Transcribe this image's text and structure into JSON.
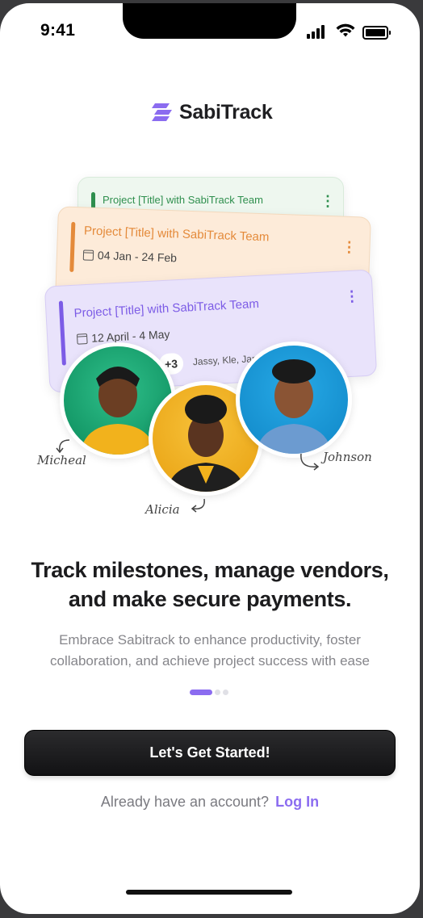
{
  "status_bar": {
    "time": "9:41"
  },
  "brand": {
    "name": "SabiTrack",
    "accent": "#8B6CF0"
  },
  "cards": [
    {
      "title": "Project [Title] with SabiTrack Team",
      "color": "#2F8F4E"
    },
    {
      "title": "Project [Title] with SabiTrack Team",
      "date": "04 Jan - 24 Feb",
      "color": "#E48A3A"
    },
    {
      "title": "Project [Title] with SabiTrack Team",
      "date": "12 April - 4 May",
      "extra_count": "+3",
      "members": "Jassy, Kle, Jame",
      "color": "#7C5CE6"
    }
  ],
  "people": [
    {
      "name": "Micheal"
    },
    {
      "name": "Alicia"
    },
    {
      "name": "Johnson"
    }
  ],
  "onboarding": {
    "headline_line1": "Track milestones, manage vendors,",
    "headline_line2": "and make secure payments.",
    "subtext_line1": "Embrace Sabitrack to enhance productivity, foster",
    "subtext_line2": "collaboration, and achieve project success with ease",
    "page_index": 1,
    "page_count": 3
  },
  "actions": {
    "primary_label": "Let's Get Started!",
    "login_prompt": "Already have an account?",
    "login_link": "Log In"
  }
}
